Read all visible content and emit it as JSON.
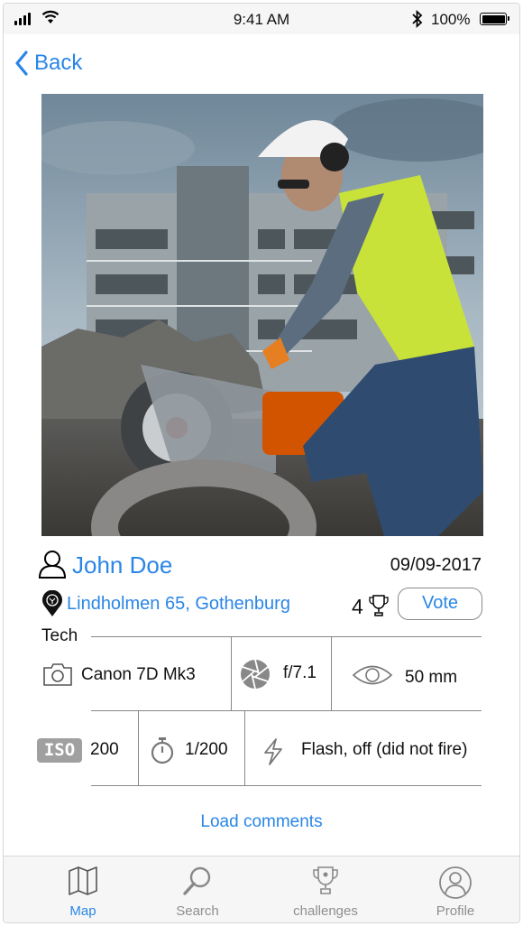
{
  "status_bar": {
    "time": "9:41 AM",
    "battery": "100%"
  },
  "nav": {
    "back_label": "Back"
  },
  "photo": {
    "subject": "worker-with-saw-photo"
  },
  "user": {
    "name": "John Doe",
    "date": "09/09-2017"
  },
  "location": {
    "text": "Lindholmen 65, Gothenburg"
  },
  "votes": {
    "count": "4",
    "button_label": "Vote"
  },
  "tech": {
    "label": "Tech",
    "camera": "Canon 7D Mk3",
    "aperture": "f/7.1",
    "focal_length": "50 mm",
    "iso_badge": "ISO",
    "iso": "200",
    "shutter": "1/200",
    "flash": "Flash, off (did not fire)"
  },
  "comments": {
    "load_label": "Load comments"
  },
  "tabs": [
    {
      "label": "Map",
      "icon": "map-icon",
      "active": true
    },
    {
      "label": "Search",
      "icon": "search-icon",
      "active": false
    },
    {
      "label": "challenges",
      "icon": "trophy-icon",
      "active": false
    },
    {
      "label": "Profile",
      "icon": "profile-icon",
      "active": false
    }
  ],
  "colors": {
    "accent": "#2a86e6",
    "tab_inactive": "#8e8e8e",
    "bar_bg": "#f6f6f6"
  }
}
